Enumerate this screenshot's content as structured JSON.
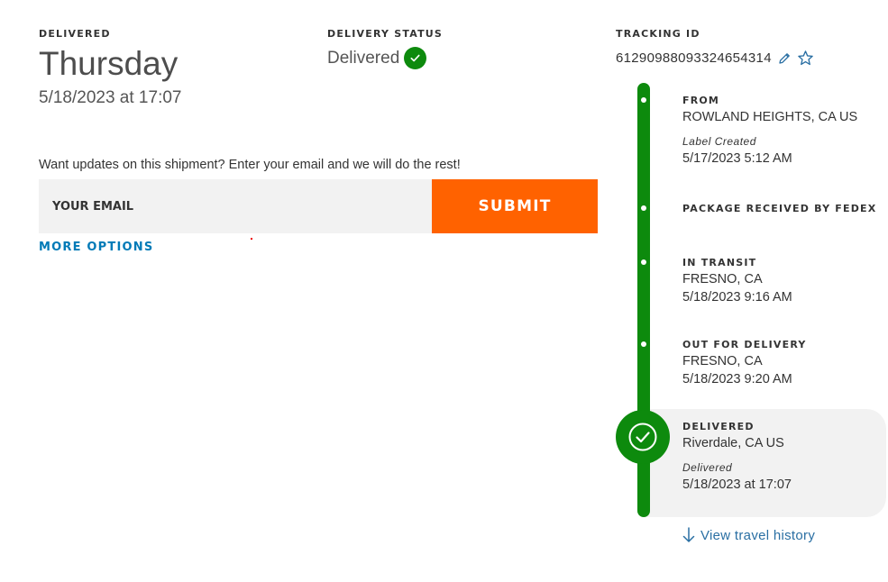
{
  "delivered": {
    "label": "DELIVERED",
    "day": "Thursday",
    "datetime": "5/18/2023 at 17:07"
  },
  "delivery_status": {
    "label": "DELIVERY STATUS",
    "value": "Delivered",
    "icon": "check-circle-icon"
  },
  "tracking": {
    "label": "TRACKING ID",
    "id": "612909880933246543​14",
    "edit_icon": "pencil-icon",
    "favorite_icon": "star-icon"
  },
  "updates": {
    "prompt": "Want updates on this shipment? Enter your email and we will do the rest!",
    "email_placeholder": "YOUR EMAIL",
    "submit_label": "SUBMIT",
    "more_options": "MORE OPTIONS"
  },
  "timeline": {
    "steps": [
      {
        "title": "FROM",
        "line1": "ROWLAND HEIGHTS, CA US",
        "note": "Label Created",
        "line2": "5/17/2023 5:12 AM"
      },
      {
        "title": "PACKAGE RECEIVED BY FEDEX"
      },
      {
        "title": "IN TRANSIT",
        "line1": "FRESNO, CA",
        "line2": "5/18/2023 9:16 AM"
      },
      {
        "title": "OUT FOR DELIVERY",
        "line1": "FRESNO, CA",
        "line2": "5/18/2023 9:20 AM"
      },
      {
        "title": "DELIVERED",
        "line1": "Riverdale, CA US",
        "note": "Delivered",
        "line2": "5/18/2023 at 17:07"
      }
    ],
    "view_history": "View travel history"
  },
  "colors": {
    "green": "#0d8a0d",
    "orange": "#ff6200",
    "link_blue": "#007ab7"
  }
}
